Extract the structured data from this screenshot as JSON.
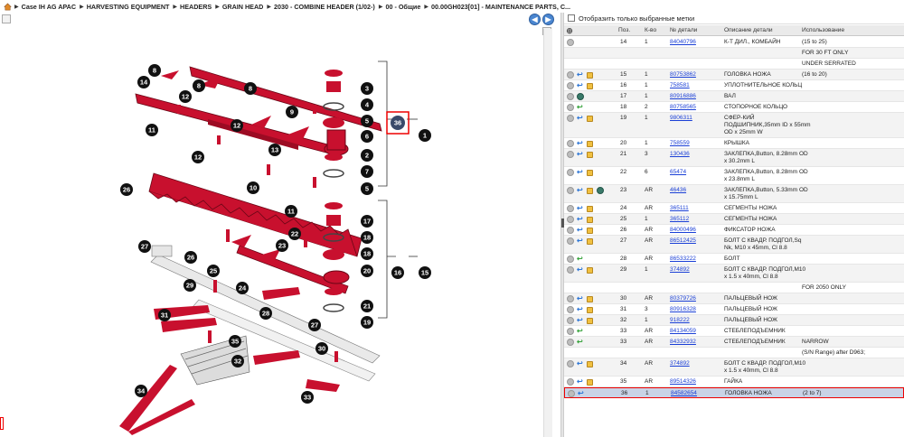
{
  "breadcrumb": {
    "items": [
      "Case IH AG APAC",
      "HARVESTING EQUIPMENT",
      "HEADERS",
      "GRAIN HEAD",
      "2030 - COMBINE HEADER (1/02-)",
      "00 - Общие",
      "00.00GH023[01] - MAINTENANCE PARTS, C..."
    ]
  },
  "filter": {
    "label": "Отобразить только выбранные метки"
  },
  "table": {
    "headers": [
      "Поз.",
      "К-во",
      "№ детали",
      "Описание детали",
      "Использование"
    ]
  },
  "rows": [
    {
      "pos": "14",
      "qty": "1",
      "part": "84040796",
      "desc": [
        "К-Т ДИЛ., КОМБАЙН"
      ],
      "use": [
        "(15 to 25)"
      ],
      "icons": [
        "grey"
      ]
    },
    {
      "pos": "",
      "qty": "",
      "part": "",
      "desc": [],
      "use": [
        "FOR 30 FT ONLY"
      ],
      "icons": []
    },
    {
      "pos": "",
      "qty": "",
      "part": "",
      "desc": [],
      "use": [
        "UNDER SERRATED"
      ],
      "icons": []
    },
    {
      "pos": "15",
      "qty": "1",
      "part": "80753862",
      "desc": [
        "ГОЛОВКА НОЖА"
      ],
      "use": [
        "(16 to 20)"
      ],
      "icons": [
        "grey",
        "arrowb",
        "box"
      ]
    },
    {
      "pos": "16",
      "qty": "1",
      "part": "758581",
      "desc": [
        "УПЛОТНИТЕЛЬНОЕ КОЛЬЦ"
      ],
      "use": [],
      "icons": [
        "grey",
        "arrowb",
        "box"
      ]
    },
    {
      "pos": "17",
      "qty": "1",
      "part": "80916886",
      "desc": [
        "ВАЛ"
      ],
      "use": [],
      "icons": [
        "grey",
        "globe"
      ]
    },
    {
      "pos": "18",
      "qty": "2",
      "part": "80758565",
      "desc": [
        "СТОПОРНОЕ КОЛЬЦО"
      ],
      "use": [],
      "icons": [
        "grey",
        "arrowg"
      ]
    },
    {
      "pos": "19",
      "qty": "1",
      "part": "9806311",
      "desc": [
        "СФЕР-КИЙ",
        "ПОДШИПНИК,35mm ID x 55mm",
        "OD x 25mm W"
      ],
      "use": [],
      "icons": [
        "grey",
        "arrowb",
        "box"
      ]
    },
    {
      "pos": "20",
      "qty": "1",
      "part": "758559",
      "desc": [
        "КРЫШКА"
      ],
      "use": [],
      "icons": [
        "grey",
        "arrowb",
        "box"
      ]
    },
    {
      "pos": "21",
      "qty": "3",
      "part": "130436",
      "desc": [
        "ЗАКЛЕПКА,Button, 8.28mm OD",
        "x 30.2mm L"
      ],
      "use": [],
      "icons": [
        "grey",
        "arrowb",
        "box"
      ]
    },
    {
      "pos": "22",
      "qty": "6",
      "part": "65474",
      "desc": [
        "ЗАКЛЕПКА,Button, 8.28mm OD",
        "x 23.8mm L"
      ],
      "use": [],
      "icons": [
        "grey",
        "arrowb",
        "box"
      ]
    },
    {
      "pos": "23",
      "qty": "AR",
      "part": "46436",
      "desc": [
        "ЗАКЛЕПКА,Button, 5.33mm OD",
        "x 15.75mm L"
      ],
      "use": [],
      "icons": [
        "grey",
        "arrowb",
        "box",
        "globe"
      ]
    },
    {
      "pos": "24",
      "qty": "AR",
      "part": "365111",
      "desc": [
        "СЕГМЕНТЫ НОЖА"
      ],
      "use": [],
      "icons": [
        "grey",
        "arrowb",
        "box"
      ]
    },
    {
      "pos": "25",
      "qty": "1",
      "part": "365112",
      "desc": [
        "СЕГМЕНТЫ НОЖА"
      ],
      "use": [],
      "icons": [
        "grey",
        "arrowb",
        "box"
      ]
    },
    {
      "pos": "26",
      "qty": "AR",
      "part": "84000496",
      "desc": [
        "ФИКСАТОР НОЖА"
      ],
      "use": [],
      "icons": [
        "grey",
        "arrowb",
        "box"
      ]
    },
    {
      "pos": "27",
      "qty": "AR",
      "part": "86512425",
      "desc": [
        "БОЛТ С КВАДР. ПОДГОЛ,Sq",
        "Nk, M10 x 45mm, Cl 8.8"
      ],
      "use": [],
      "icons": [
        "grey",
        "arrowb",
        "box"
      ]
    },
    {
      "pos": "28",
      "qty": "AR",
      "part": "86533222",
      "desc": [
        "БОЛТ"
      ],
      "use": [],
      "icons": [
        "grey",
        "arrowg"
      ]
    },
    {
      "pos": "29",
      "qty": "1",
      "part": "374892",
      "desc": [
        "БОЛТ С КВАДР. ПОДГОЛ,M10",
        "x 1.5 x 40mm, Cl 8.8"
      ],
      "use": [],
      "icons": [
        "grey",
        "arrowb",
        "box"
      ]
    },
    {
      "pos": "",
      "qty": "",
      "part": "",
      "desc": [],
      "use": [
        "FOR 2050 ONLY"
      ],
      "icons": []
    },
    {
      "pos": "30",
      "qty": "AR",
      "part": "80379726",
      "desc": [
        "ПАЛЬЦЕВЫЙ НОЖ"
      ],
      "use": [],
      "icons": [
        "grey",
        "arrowb",
        "box"
      ]
    },
    {
      "pos": "31",
      "qty": "3",
      "part": "80916328",
      "desc": [
        "ПАЛЬЦЕВЫЙ НОЖ"
      ],
      "use": [],
      "icons": [
        "grey",
        "arrowb",
        "box"
      ]
    },
    {
      "pos": "32",
      "qty": "1",
      "part": "918222",
      "desc": [
        "ПАЛЬЦЕВЫЙ НОЖ"
      ],
      "use": [],
      "icons": [
        "grey",
        "arrowb",
        "box"
      ]
    },
    {
      "pos": "33",
      "qty": "AR",
      "part": "84134059",
      "desc": [
        "СТЕБЛЕПОДЪЕМНИК"
      ],
      "use": [],
      "icons": [
        "grey",
        "arrowg"
      ]
    },
    {
      "pos": "33",
      "qty": "AR",
      "part": "84332932",
      "desc": [
        "СТЕБЛЕПОДЪЕМНИК"
      ],
      "use": [
        "NARROW"
      ],
      "icons": [
        "grey",
        "arrowg"
      ]
    },
    {
      "pos": "",
      "qty": "",
      "part": "",
      "desc": [],
      "use": [
        "(S/N Range) after D963;"
      ],
      "icons": []
    },
    {
      "pos": "34",
      "qty": "AR",
      "part": "374892",
      "desc": [
        "БОЛТ С КВАДР. ПОДГОЛ,M10",
        "x 1.5 x 40mm, Cl 8.8"
      ],
      "use": [],
      "icons": [
        "grey",
        "arrowb",
        "box"
      ]
    },
    {
      "pos": "35",
      "qty": "AR",
      "part": "89514326",
      "desc": [
        "ГАЙКА"
      ],
      "use": [],
      "icons": [
        "grey",
        "arrowb",
        "box"
      ]
    },
    {
      "pos": "36",
      "qty": "1",
      "part": "84582654",
      "desc": [
        "ГОЛОВКА НОЖА"
      ],
      "use": [
        "(2 to 7)"
      ],
      "icons": [
        "grey",
        "arrowb"
      ],
      "selected": true
    }
  ],
  "callouts": [
    "1",
    "2",
    "3",
    "4",
    "5",
    "5",
    "6",
    "7",
    "8",
    "8",
    "8",
    "9",
    "10",
    "11",
    "11",
    "12",
    "12",
    "12",
    "13",
    "14",
    "15",
    "16",
    "17",
    "18",
    "18",
    "19",
    "20",
    "21",
    "22",
    "23",
    "24",
    "25",
    "26",
    "26",
    "27",
    "27",
    "28",
    "29",
    "30",
    "31",
    "32",
    "33",
    "34",
    "35",
    "36"
  ],
  "colors": {
    "part_red": "#c8102e",
    "callout": "#111111",
    "highlight": "#e00000",
    "link": "#1a3fd6"
  }
}
